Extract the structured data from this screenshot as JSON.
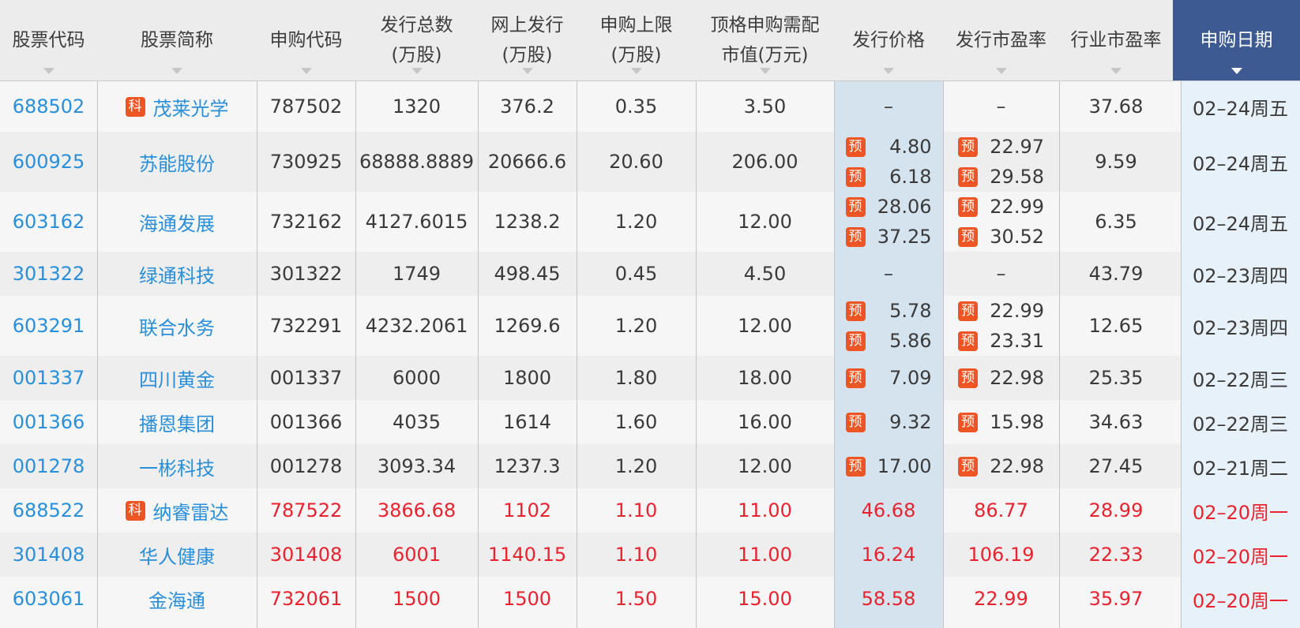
{
  "headers": {
    "stock_code": "股票代码",
    "stock_name": "股票简称",
    "sub_code": "申购代码",
    "total_issue_1": "发行总数",
    "total_issue_2": "(万股)",
    "online_issue_1": "网上发行",
    "online_issue_2": "(万股)",
    "limit_1": "申购上限",
    "limit_2": "(万股)",
    "mv_1": "顶格申购需配",
    "mv_2": "市值(万元)",
    "price": "发行价格",
    "pe": "发行市盈率",
    "industry_pe": "行业市盈率",
    "date": "申购日期"
  },
  "badges": {
    "pre": "预",
    "star": "科"
  },
  "colors": {
    "link": "#2a8fd8",
    "red": "#e8232f",
    "header_active": "#3d5b92",
    "price_column_bg": "#d4e3ee",
    "date_column_bg": "#e7f1f9",
    "badge": "#ee5524"
  },
  "rows": [
    {
      "code": "688502",
      "name": "茂莱光学",
      "star": true,
      "sub_code": "787502",
      "total": "1320",
      "online": "376.2",
      "limit": "0.35",
      "mv": "3.50",
      "price": [
        "–"
      ],
      "price_pre": false,
      "pe": [
        "–"
      ],
      "pe_pre": false,
      "ind_pe": "37.68",
      "date": "02–24周五",
      "red": false
    },
    {
      "code": "600925",
      "name": "苏能股份",
      "star": false,
      "sub_code": "730925",
      "total": "68888.8889",
      "online": "20666.6",
      "limit": "20.60",
      "mv": "206.00",
      "price": [
        "4.80",
        "6.18"
      ],
      "price_pre": true,
      "pe": [
        "22.97",
        "29.58"
      ],
      "pe_pre": true,
      "ind_pe": "9.59",
      "date": "02–24周五",
      "red": false
    },
    {
      "code": "603162",
      "name": "海通发展",
      "star": false,
      "sub_code": "732162",
      "total": "4127.6015",
      "online": "1238.2",
      "limit": "1.20",
      "mv": "12.00",
      "price": [
        "28.06",
        "37.25"
      ],
      "price_pre": true,
      "pe": [
        "22.99",
        "30.52"
      ],
      "pe_pre": true,
      "ind_pe": "6.35",
      "date": "02–24周五",
      "red": false
    },
    {
      "code": "301322",
      "name": "绿通科技",
      "star": false,
      "sub_code": "301322",
      "total": "1749",
      "online": "498.45",
      "limit": "0.45",
      "mv": "4.50",
      "price": [
        "–"
      ],
      "price_pre": false,
      "pe": [
        "–"
      ],
      "pe_pre": false,
      "ind_pe": "43.79",
      "date": "02–23周四",
      "red": false
    },
    {
      "code": "603291",
      "name": "联合水务",
      "star": false,
      "sub_code": "732291",
      "total": "4232.2061",
      "online": "1269.6",
      "limit": "1.20",
      "mv": "12.00",
      "price": [
        "5.78",
        "5.86"
      ],
      "price_pre": true,
      "pe": [
        "22.99",
        "23.31"
      ],
      "pe_pre": true,
      "ind_pe": "12.65",
      "date": "02–23周四",
      "red": false
    },
    {
      "code": "001337",
      "name": "四川黄金",
      "star": false,
      "sub_code": "001337",
      "total": "6000",
      "online": "1800",
      "limit": "1.80",
      "mv": "18.00",
      "price": [
        "7.09"
      ],
      "price_pre": true,
      "pe": [
        "22.98"
      ],
      "pe_pre": true,
      "ind_pe": "25.35",
      "date": "02–22周三",
      "red": false
    },
    {
      "code": "001366",
      "name": "播恩集团",
      "star": false,
      "sub_code": "001366",
      "total": "4035",
      "online": "1614",
      "limit": "1.60",
      "mv": "16.00",
      "price": [
        "9.32"
      ],
      "price_pre": true,
      "pe": [
        "15.98"
      ],
      "pe_pre": true,
      "ind_pe": "34.63",
      "date": "02–22周三",
      "red": false
    },
    {
      "code": "001278",
      "name": "一彬科技",
      "star": false,
      "sub_code": "001278",
      "total": "3093.34",
      "online": "1237.3",
      "limit": "1.20",
      "mv": "12.00",
      "price": [
        "17.00"
      ],
      "price_pre": true,
      "pe": [
        "22.98"
      ],
      "pe_pre": true,
      "ind_pe": "27.45",
      "date": "02–21周二",
      "red": false
    },
    {
      "code": "688522",
      "name": "纳睿雷达",
      "star": true,
      "sub_code": "787522",
      "total": "3866.68",
      "online": "1102",
      "limit": "1.10",
      "mv": "11.00",
      "price": [
        "46.68"
      ],
      "price_pre": false,
      "pe": [
        "86.77"
      ],
      "pe_pre": false,
      "ind_pe": "28.99",
      "date": "02–20周一",
      "red": true
    },
    {
      "code": "301408",
      "name": "华人健康",
      "star": false,
      "sub_code": "301408",
      "total": "6001",
      "online": "1140.15",
      "limit": "1.10",
      "mv": "11.00",
      "price": [
        "16.24"
      ],
      "price_pre": false,
      "pe": [
        "106.19"
      ],
      "pe_pre": false,
      "ind_pe": "22.33",
      "date": "02–20周一",
      "red": true
    },
    {
      "code": "603061",
      "name": "金海通",
      "star": false,
      "sub_code": "732061",
      "total": "1500",
      "online": "1500",
      "limit": "1.50",
      "mv": "15.00",
      "price": [
        "58.58"
      ],
      "price_pre": false,
      "pe": [
        "22.99"
      ],
      "pe_pre": false,
      "ind_pe": "35.97",
      "date": "02–20周一",
      "red": true
    }
  ]
}
